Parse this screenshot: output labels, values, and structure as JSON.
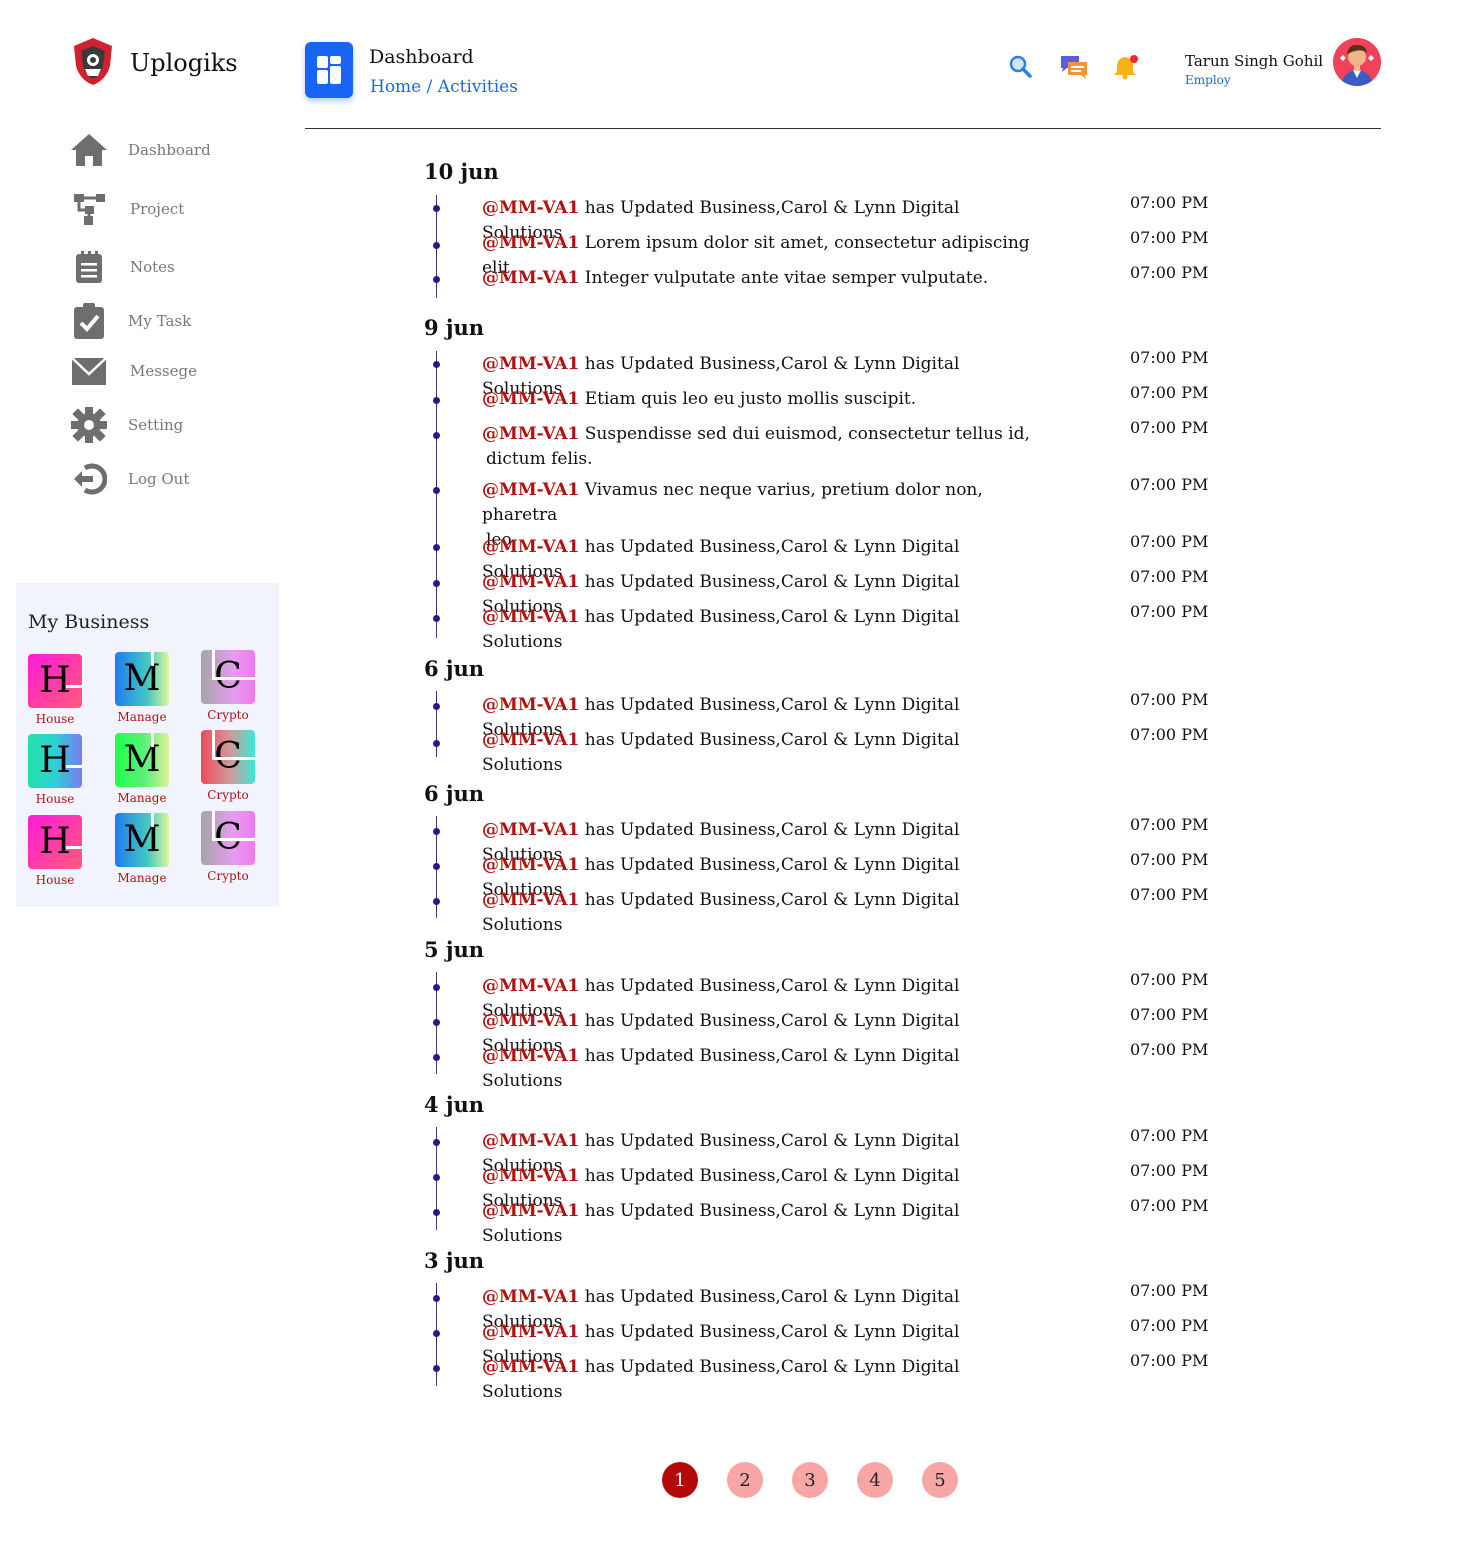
{
  "brand": {
    "name": "Uplogiks",
    "logo_icon": "shield-logo-icon"
  },
  "sidebar": {
    "items": [
      {
        "label": "Dashboard",
        "icon": "home-icon"
      },
      {
        "label": "Project",
        "icon": "project-tree-icon"
      },
      {
        "label": "Notes",
        "icon": "notes-icon"
      },
      {
        "label": "My Task",
        "icon": "clipboard-check-icon"
      },
      {
        "label": "Messege",
        "icon": "mail-icon"
      },
      {
        "label": "Setting",
        "icon": "gear-icon"
      },
      {
        "label": "Log Out",
        "icon": "logout-icon"
      }
    ]
  },
  "my_business": {
    "title": "My Business",
    "tiles": [
      {
        "letter": "H",
        "label": "House"
      },
      {
        "letter": "M",
        "label": "Manage"
      },
      {
        "letter": "C",
        "label": "Crypto"
      },
      {
        "letter": "H",
        "label": "House"
      },
      {
        "letter": "M",
        "label": "Manage"
      },
      {
        "letter": "C",
        "label": "Crypto"
      },
      {
        "letter": "H",
        "label": "House"
      },
      {
        "letter": "M",
        "label": "Manage"
      },
      {
        "letter": "C",
        "label": "Crypto"
      }
    ]
  },
  "header": {
    "title": "Dashboard",
    "breadcrumb": {
      "home": "Home",
      "separator": " / ",
      "current": "Activities"
    },
    "tools": [
      "search-icon",
      "chat-icon",
      "bell-icon"
    ],
    "user": {
      "name": "Tarun Singh Gohil",
      "role": "Employ"
    }
  },
  "timeline": [
    {
      "date": "10 jun",
      "entries": [
        {
          "user": "@MM-VA1",
          "text": "has Updated Business,Carol & Lynn Digital Solutions",
          "time": "07:00 PM"
        },
        {
          "user": "@MM-VA1",
          "text": "Lorem ipsum dolor sit amet, consectetur adipiscing elit.",
          "time": "07:00 PM"
        },
        {
          "user": "@MM-VA1",
          "text": "Integer vulputate ante vitae semper vulputate.",
          "time": "07:00 PM"
        }
      ]
    },
    {
      "date": "9 jun",
      "entries": [
        {
          "user": "@MM-VA1",
          "text": "has Updated Business,Carol & Lynn Digital Solutions",
          "time": "07:00 PM"
        },
        {
          "user": "@MM-VA1",
          "text": "Etiam quis leo eu justo mollis suscipit.",
          "time": "07:00 PM"
        },
        {
          "user": "@MM-VA1",
          "text": "Suspendisse sed dui euismod, consectetur tellus id,",
          "text2": "dictum felis.",
          "time": "07:00 PM"
        },
        {
          "user": "@MM-VA1",
          "text": "Vivamus nec neque varius, pretium dolor non, pharetra",
          "text2": "leo.",
          "time": "07:00 PM"
        },
        {
          "user": "@MM-VA1",
          "text": "has Updated Business,Carol & Lynn Digital Solutions",
          "time": "07:00 PM"
        },
        {
          "user": "@MM-VA1",
          "text": "has Updated Business,Carol & Lynn Digital Solutions",
          "time": "07:00 PM"
        },
        {
          "user": "@MM-VA1",
          "text": "has Updated Business,Carol & Lynn Digital Solutions",
          "time": "07:00 PM"
        }
      ]
    },
    {
      "date": "6 jun",
      "entries": [
        {
          "user": "@MM-VA1",
          "text": "has Updated Business,Carol & Lynn Digital Solutions",
          "time": "07:00 PM"
        },
        {
          "user": "@MM-VA1",
          "text": "has Updated Business,Carol & Lynn Digital Solutions",
          "time": "07:00 PM"
        }
      ]
    },
    {
      "date": "6 jun",
      "entries": [
        {
          "user": "@MM-VA1",
          "text": "has Updated Business,Carol & Lynn Digital Solutions",
          "time": "07:00 PM"
        },
        {
          "user": "@MM-VA1",
          "text": "has Updated Business,Carol & Lynn Digital Solutions",
          "time": "07:00 PM"
        },
        {
          "user": "@MM-VA1",
          "text": "has Updated Business,Carol & Lynn Digital Solutions",
          "time": "07:00 PM"
        }
      ]
    },
    {
      "date": "5 jun",
      "entries": [
        {
          "user": "@MM-VA1",
          "text": "has Updated Business,Carol & Lynn Digital Solutions",
          "time": "07:00 PM"
        },
        {
          "user": "@MM-VA1",
          "text": "has Updated Business,Carol & Lynn Digital Solutions",
          "time": "07:00 PM"
        },
        {
          "user": "@MM-VA1",
          "text": "has Updated Business,Carol & Lynn Digital Solutions",
          "time": "07:00 PM"
        }
      ]
    },
    {
      "date": "4 jun",
      "entries": [
        {
          "user": "@MM-VA1",
          "text": "has Updated Business,Carol & Lynn Digital Solutions",
          "time": "07:00 PM"
        },
        {
          "user": "@MM-VA1",
          "text": "has Updated Business,Carol & Lynn Digital Solutions",
          "time": "07:00 PM"
        },
        {
          "user": "@MM-VA1",
          "text": "has Updated Business,Carol & Lynn Digital Solutions",
          "time": "07:00 PM"
        }
      ]
    },
    {
      "date": "3 jun",
      "entries": [
        {
          "user": "@MM-VA1",
          "text": "has Updated Business,Carol & Lynn Digital Solutions",
          "time": "07:00 PM"
        },
        {
          "user": "@MM-VA1",
          "text": "has Updated Business,Carol & Lynn Digital Solutions",
          "time": "07:00 PM"
        },
        {
          "user": "@MM-VA1",
          "text": "has Updated Business,Carol & Lynn Digital Solutions",
          "time": "07:00 PM"
        }
      ]
    }
  ],
  "pagination": {
    "pages": [
      "1",
      "2",
      "3",
      "4",
      "5"
    ],
    "current": "1"
  },
  "colors": {
    "accent": "#1a64f5",
    "user_red": "#b01212",
    "page_active": "#b30a0a",
    "page_idle": "#f7a5a5",
    "timeline_dot": "#241a8a"
  }
}
